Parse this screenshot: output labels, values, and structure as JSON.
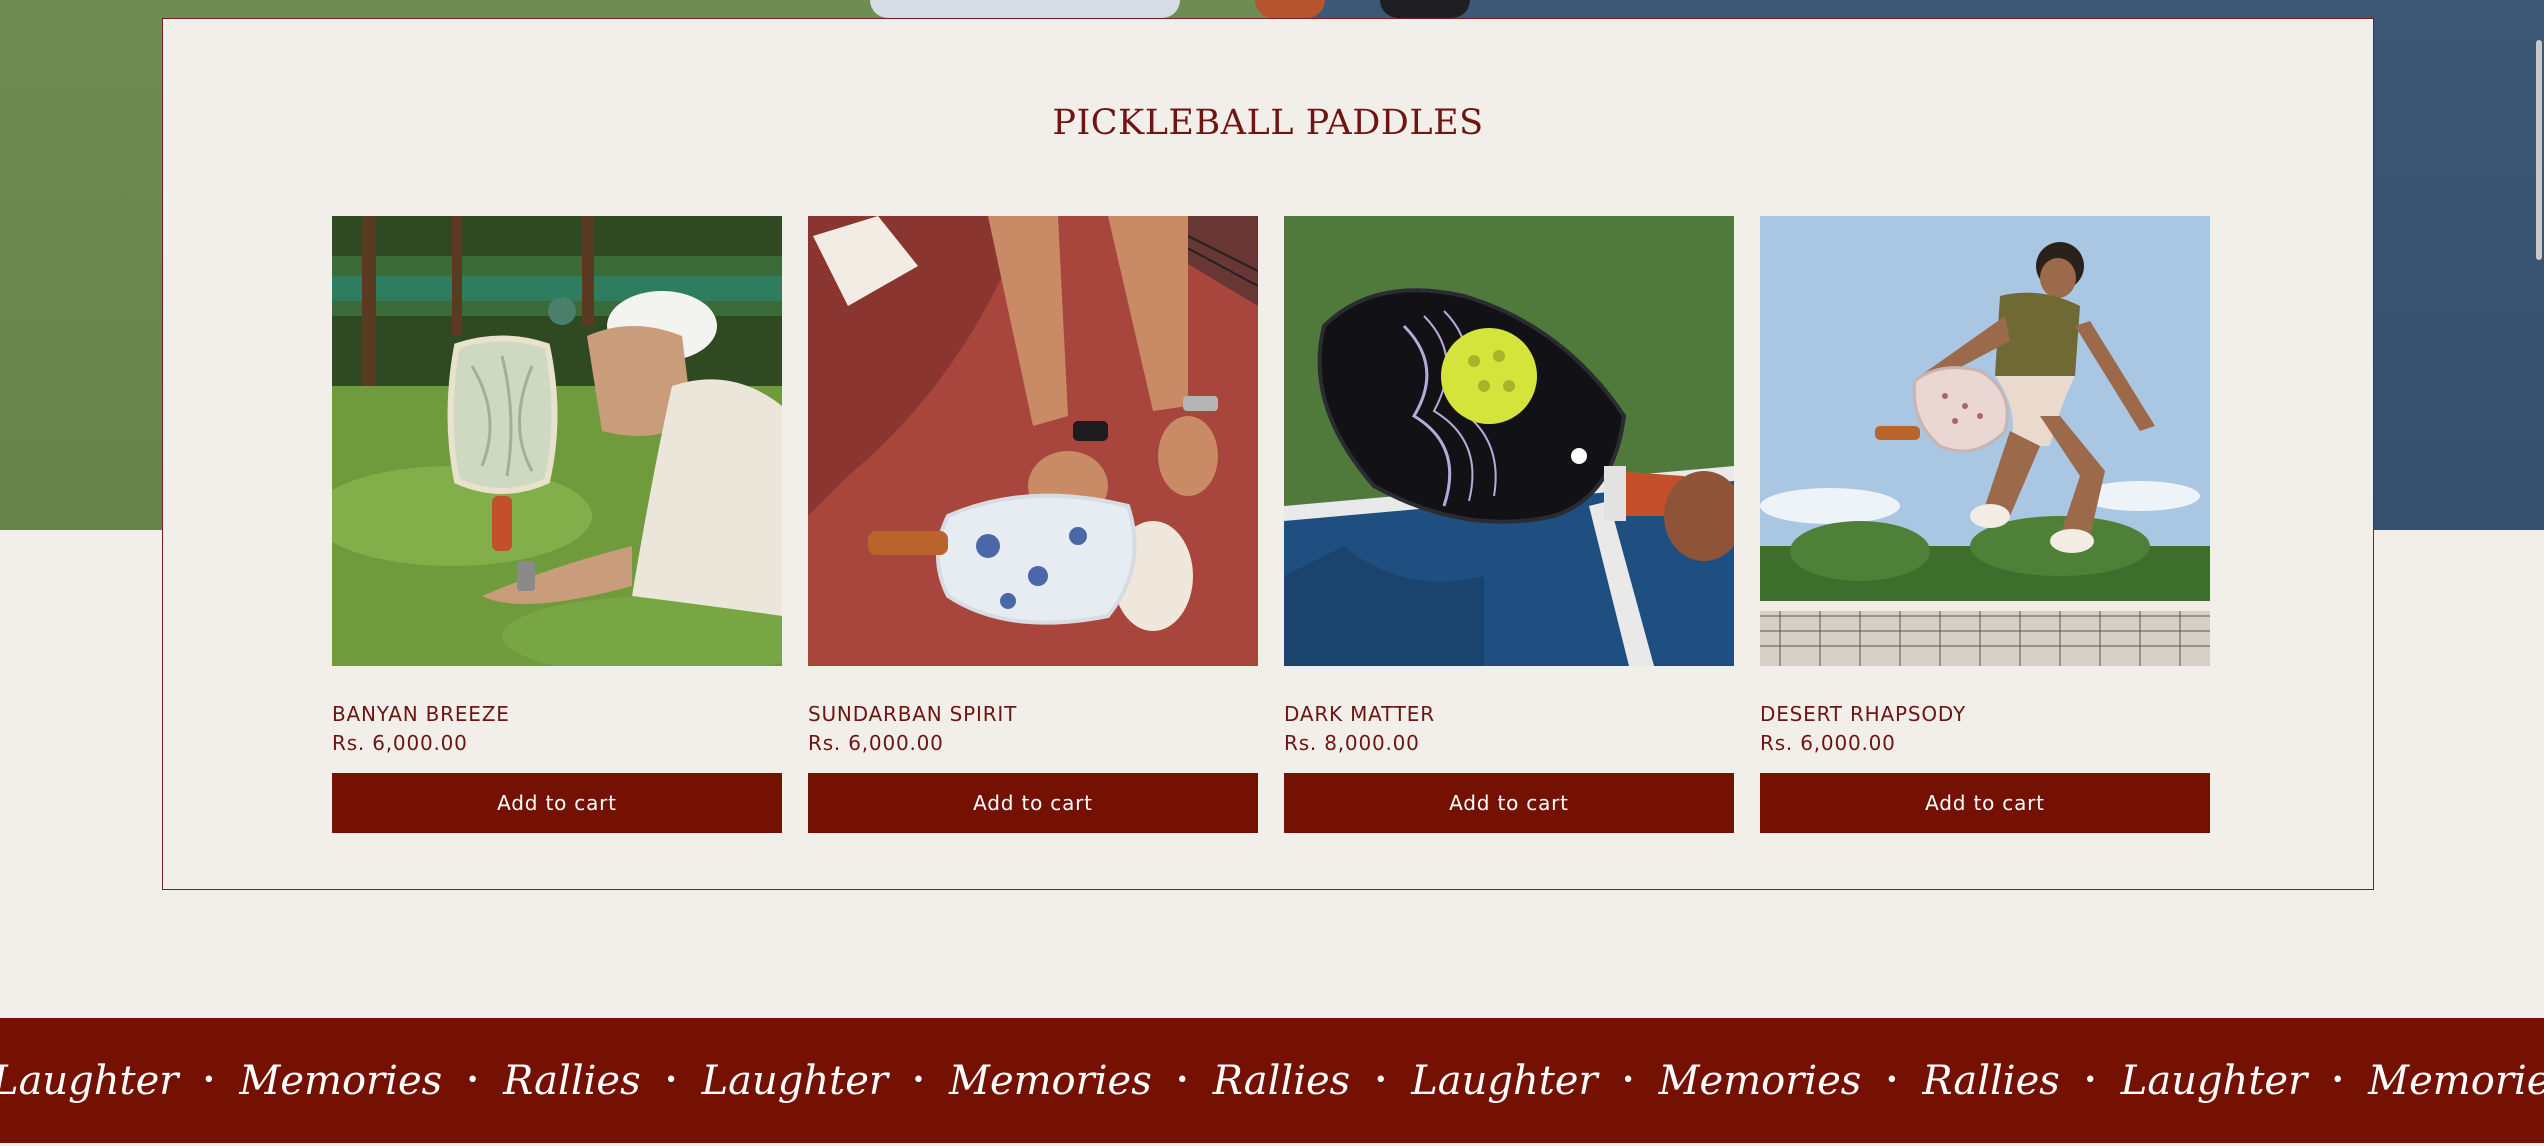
{
  "section": {
    "title": "PICKLEBALL PADDLES"
  },
  "products": [
    {
      "name": "BANYAN BREEZE",
      "price": "Rs. 6,000.00",
      "button": "Add to cart",
      "image": "woman-lying-on-grass-with-green-paddle"
    },
    {
      "name": "SUNDARBAN SPIRIT",
      "price": "Rs. 6,000.00",
      "button": "Add to cart",
      "image": "player-tying-shoe-with-blue-floral-paddle"
    },
    {
      "name": "DARK MATTER",
      "price": "Rs. 8,000.00",
      "button": "Add to cart",
      "image": "black-paddle-with-yellow-ball-on-court"
    },
    {
      "name": "DESERT RHAPSODY",
      "price": "Rs. 6,000.00",
      "button": "Add to cart",
      "image": "man-jumping-with-pink-paddle"
    }
  ],
  "marquee": {
    "separator": "•",
    "words": [
      "Laughter",
      "Memories",
      "Rallies",
      "Laughter",
      "Memories",
      "Rallies",
      "Laughter",
      "Memories",
      "Rallies",
      "Laughter",
      "Memories",
      "Rallies",
      "Laughter"
    ]
  },
  "colors": {
    "brand": "#741103",
    "text": "#6e1411",
    "background": "#f2efea"
  }
}
